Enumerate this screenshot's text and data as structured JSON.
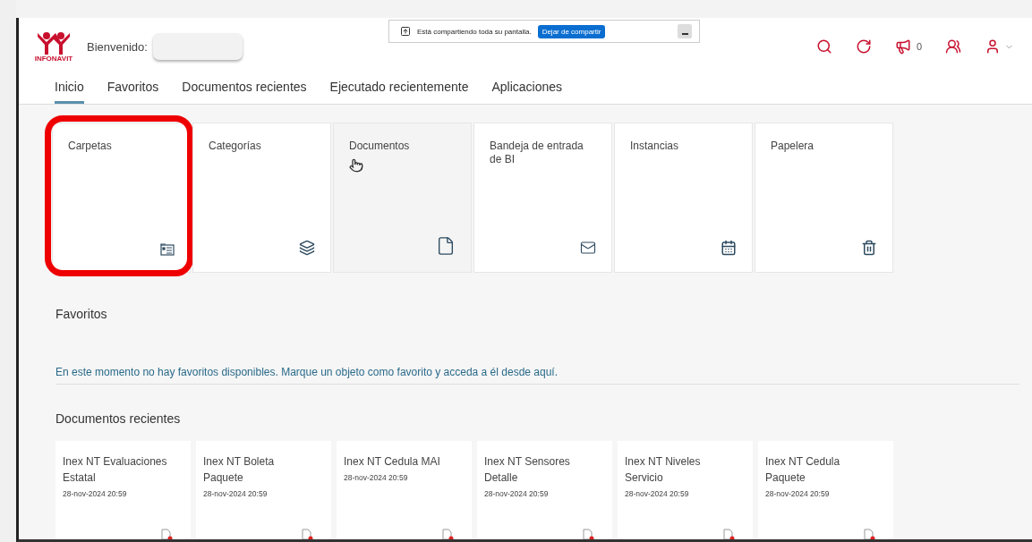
{
  "header": {
    "logo_text": "INFONAVIT",
    "greeting": "Bienvenido:",
    "notification_count": "0"
  },
  "share_bar": {
    "message": "Está compartiendo toda su pantalla.",
    "stop_button": "Dejar de compartir"
  },
  "tabs": [
    {
      "label": "Inicio",
      "selected": true
    },
    {
      "label": "Favoritos",
      "selected": false
    },
    {
      "label": "Documentos recientes",
      "selected": false
    },
    {
      "label": "Ejecutado recientemente",
      "selected": false
    },
    {
      "label": "Aplicaciones",
      "selected": false
    }
  ],
  "tiles": [
    {
      "label": "Carpetas",
      "kind": "folders",
      "highlighted": true,
      "hovered": false
    },
    {
      "label": "Categorías",
      "kind": "categories",
      "highlighted": false,
      "hovered": false
    },
    {
      "label": "Documentos",
      "kind": "documents",
      "highlighted": false,
      "hovered": true
    },
    {
      "label": "Bandeja de entrada de BI",
      "kind": "inbox",
      "highlighted": false,
      "hovered": false
    },
    {
      "label": "Instancias",
      "kind": "instances",
      "highlighted": false,
      "hovered": false
    },
    {
      "label": "Papelera",
      "kind": "trash",
      "highlighted": false,
      "hovered": false
    }
  ],
  "favorites": {
    "title": "Favoritos",
    "message": "En este momento no hay favoritos disponibles. Marque un objeto como favorito y acceda a él desde aquí."
  },
  "recent": {
    "title": "Documentos recientes",
    "items": [
      {
        "name": "Inex NT Evaluaciones Estatal",
        "date": "28-nov-2024 20:59"
      },
      {
        "name": "Inex NT Boleta Paquete",
        "date": "28-nov-2024 20:59"
      },
      {
        "name": "Inex NT Cedula MAI",
        "date": "28-nov-2024 20:59"
      },
      {
        "name": "Inex NT Sensores Detalle",
        "date": "28-nov-2024 20:59"
      },
      {
        "name": "Inex NT Niveles Servicio",
        "date": "28-nov-2024 20:59"
      },
      {
        "name": "Inex NT Cedula Paquete",
        "date": "28-nov-2024 20:59"
      }
    ]
  }
}
